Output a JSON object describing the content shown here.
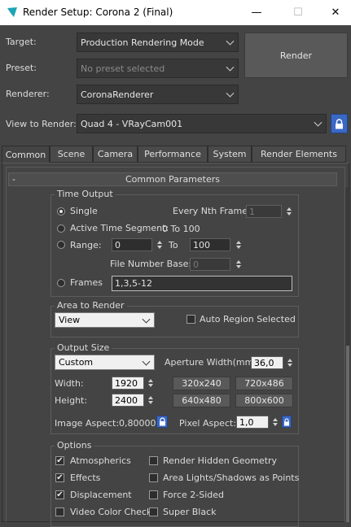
{
  "window": {
    "title": "Render Setup: Corona 2 (Final)",
    "minimize_glyph": "—",
    "maximize_glyph": "☐",
    "close_glyph": "✕",
    "icon": "3ds-max-icon",
    "colors": {
      "titlebar": "#ffffff",
      "panel": "#444444",
      "accent": "#3a68c6"
    }
  },
  "top": {
    "target_label": "Target:",
    "target_value": "Production Rendering Mode",
    "preset_label": "Preset:",
    "preset_value": "No preset selected",
    "renderer_label": "Renderer:",
    "renderer_value": "CoronaRenderer",
    "view_label": "View to Render:",
    "view_value": "Quad 4 - VRayCam001",
    "render_button": "Render",
    "lock_icon": "lock-icon"
  },
  "tabs": [
    {
      "label": "Common",
      "active": true
    },
    {
      "label": "Scene"
    },
    {
      "label": "Camera"
    },
    {
      "label": "Performance"
    },
    {
      "label": "System"
    },
    {
      "label": "Render Elements"
    }
  ],
  "rollout": {
    "collapse_glyph": "-",
    "title": "Common Parameters"
  },
  "time_output": {
    "title": "Time Output",
    "single": "Single",
    "every_nth_label": "Every Nth Frame:",
    "every_nth_value": "1",
    "active_segment": "Active Time Segment:",
    "active_segment_value": "0 To 100",
    "range": "Range:",
    "range_from": "0",
    "range_to_label": "To",
    "range_to": "100",
    "file_number_base_label": "File Number Base:",
    "file_number_base": "0",
    "frames": "Frames",
    "frames_value": "1,3,5-12",
    "selected": "single"
  },
  "area": {
    "title": "Area to Render",
    "value": "View",
    "auto_region": "Auto Region Selected",
    "auto_region_checked": false
  },
  "output_size": {
    "title": "Output Size",
    "preset": "Custom",
    "aperture_label": "Aperture Width(mm):",
    "aperture_value": "36,0",
    "width_label": "Width:",
    "width": "1920",
    "height_label": "Height:",
    "height": "2400",
    "presets": [
      "320x240",
      "720x486",
      "640x480",
      "800x600"
    ],
    "image_aspect": "Image Aspect:0,80000",
    "pixel_aspect_label": "Pixel Aspect:",
    "pixel_aspect": "1,0"
  },
  "options": {
    "title": "Options",
    "left": [
      {
        "label": "Atmospherics",
        "checked": true
      },
      {
        "label": "Effects",
        "checked": true
      },
      {
        "label": "Displacement",
        "checked": true
      },
      {
        "label": "Video Color Check",
        "checked": false
      }
    ],
    "right": [
      {
        "label": "Render Hidden Geometry",
        "checked": false
      },
      {
        "label": "Area Lights/Shadows as Points",
        "checked": false
      },
      {
        "label": "Force 2-Sided",
        "checked": false
      },
      {
        "label": "Super Black",
        "checked": false
      }
    ],
    "check_glyph": "✔"
  }
}
